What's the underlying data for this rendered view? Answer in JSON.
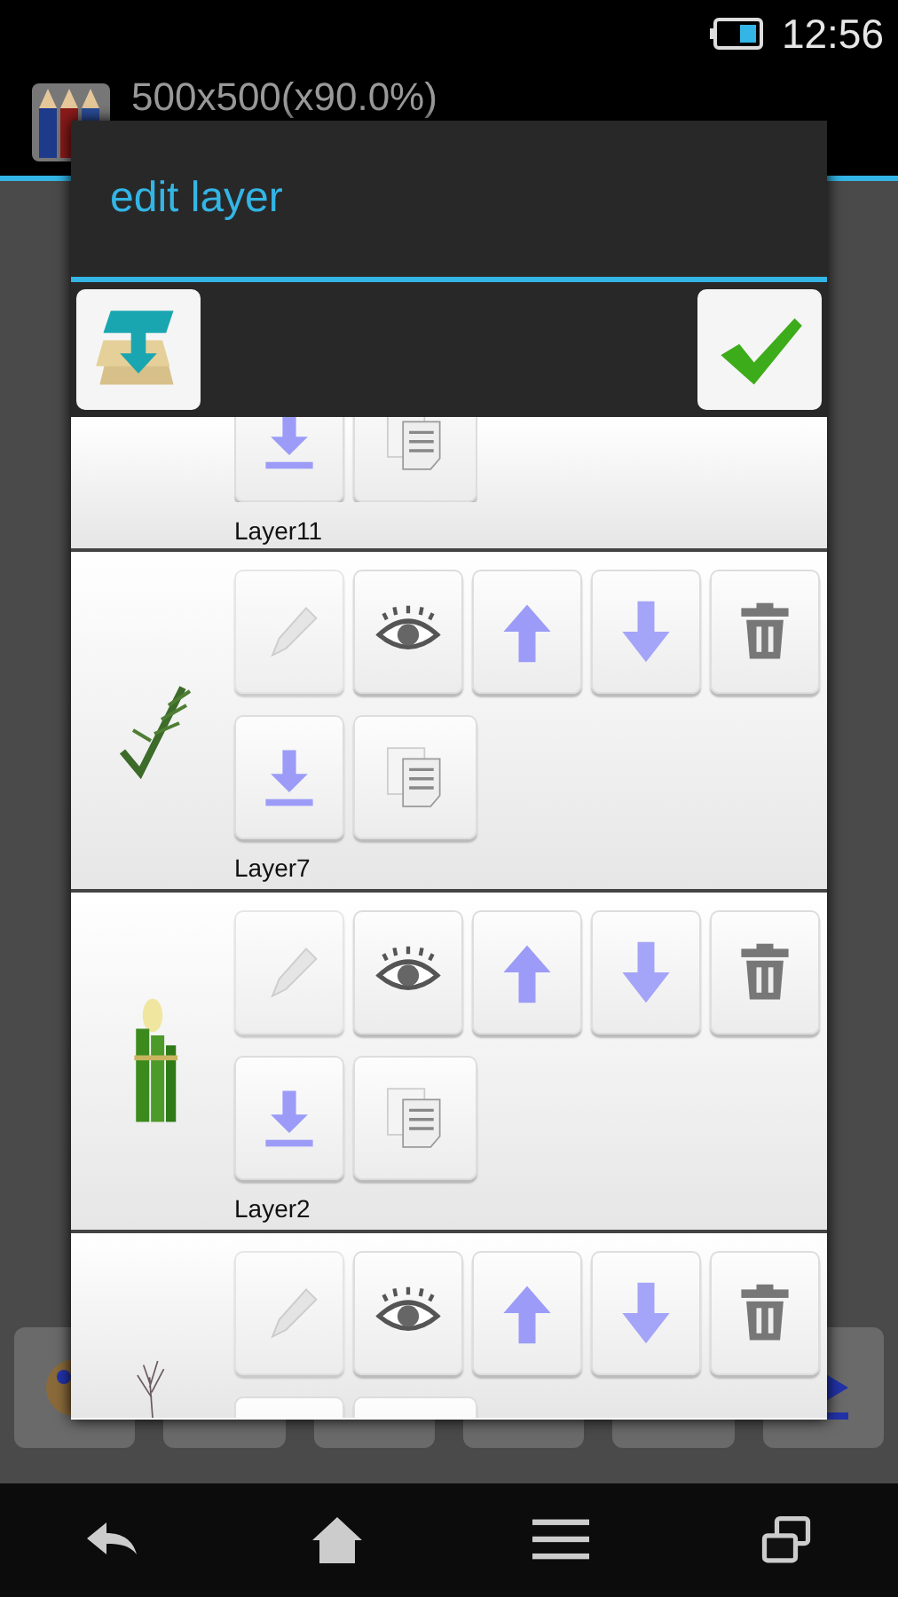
{
  "status_bar": {
    "time": "12:56"
  },
  "app_bar": {
    "title": "500x500(x90.0%)"
  },
  "dialog": {
    "title": "edit layer",
    "layers": [
      {
        "name": "Layer11"
      },
      {
        "name": "Layer7",
        "edit_disabled": true
      },
      {
        "name": "Layer2",
        "edit_disabled": true
      },
      {
        "edit_disabled": true
      }
    ]
  }
}
